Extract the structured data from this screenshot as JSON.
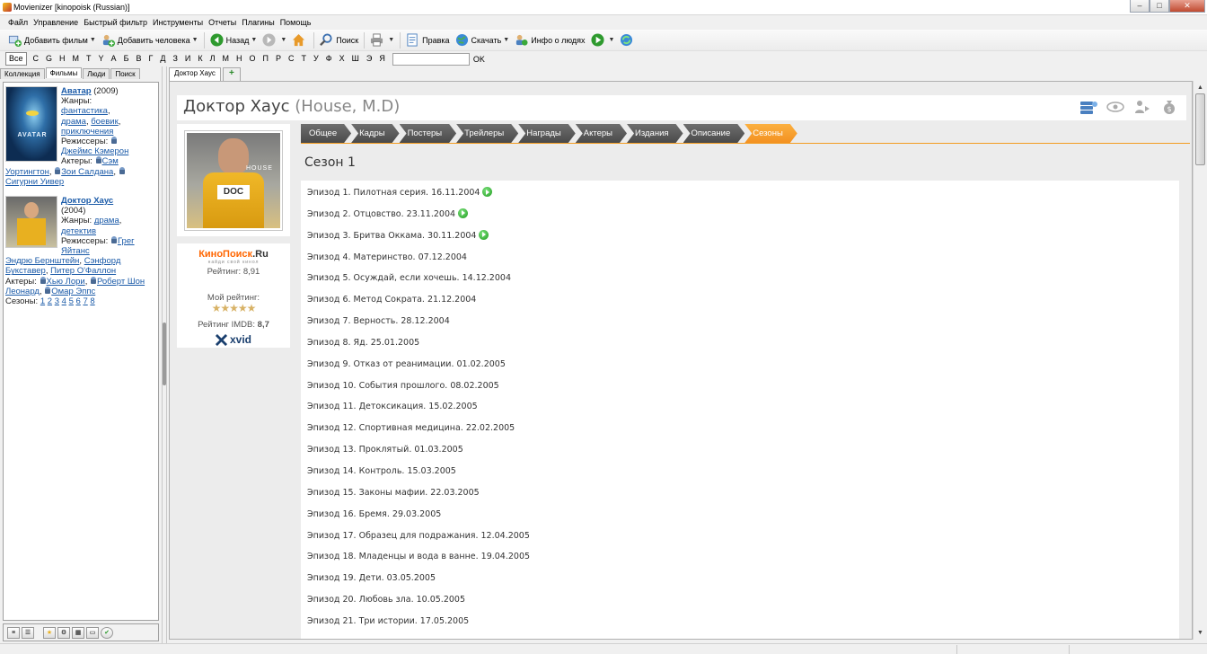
{
  "window": {
    "title": "Movienizer [kinopoisk (Russian)]"
  },
  "menu": [
    "Файл",
    "Управление",
    "Быстрый фильтр",
    "Инструменты",
    "Отчеты",
    "Плагины",
    "Помощь"
  ],
  "toolbar": {
    "add_movie": "Добавить фильм",
    "add_person": "Добавить человека",
    "back": "Назад",
    "search": "Поиск",
    "edit": "Правка",
    "download": "Скачать",
    "people_info": "Инфо о людях"
  },
  "alphabet": {
    "all": "Все",
    "letters": [
      "C",
      "G",
      "H",
      "M",
      "T",
      "Y",
      "А",
      "Б",
      "В",
      "Г",
      "Д",
      "З",
      "И",
      "К",
      "Л",
      "М",
      "Н",
      "О",
      "П",
      "Р",
      "С",
      "Т",
      "У",
      "Ф",
      "Х",
      "Ш",
      "Э",
      "Я"
    ],
    "ok": "OK",
    "filter_value": ""
  },
  "left_tabs": [
    "Коллекция",
    "Фильмы",
    "Люди",
    "Поиск"
  ],
  "left_active_tab": "Фильмы",
  "movies": [
    {
      "title": "Аватар",
      "year": "(2009)",
      "genres_label": "Жанры:",
      "genres": [
        "фантастика",
        "драма",
        "боевик",
        "приключения"
      ],
      "directors_label": "Режиссеры:",
      "directors": [
        "Джеймс Кэмерон"
      ],
      "actors_label": "Актеры:",
      "actors": [
        "Сэм Уортингтон",
        "Зои Салдана",
        "Сигурни Уивер"
      ],
      "poster_text": "AVATAR"
    },
    {
      "title": "Доктор Хаус",
      "year": "(2004)",
      "genres_label": "Жанры:",
      "genres": [
        "драма",
        "детектив"
      ],
      "directors_label": "Режиссеры:",
      "directors": [
        "Грег Яйтанс",
        "Эндрю Бернштейн",
        "Сэнфорд Букставер",
        "Питер О'Фаллон"
      ],
      "actors_label": "Актеры:",
      "actors": [
        "Хью Лори",
        "Роберт Шон Леонард",
        "Омар Эппс"
      ],
      "seasons_label": "Сезоны:",
      "seasons": [
        "1",
        "2",
        "3",
        "4",
        "5",
        "6",
        "7",
        "8"
      ]
    }
  ],
  "doc_tab": "Доктор Хаус",
  "detail": {
    "title": "Доктор Хаус",
    "original_title": "(House, M.D)",
    "poster_text": "HOUSE",
    "poster_sign": "DOC",
    "kinopoisk_logo_a": "КиноПоиск",
    "kinopoisk_logo_b": ".Ru",
    "kinopoisk_slogan": "найди свой кинол",
    "kinopoisk_rating": "Рейтинг: 8,91",
    "my_rating_label": "Мой рейтинг:",
    "imdb_label": "Рейтинг IMDB:",
    "imdb_value": "8,7",
    "xvid": "xvid",
    "tabs": [
      "Общее",
      "Кадры",
      "Постеры",
      "Трейлеры",
      "Награды",
      "Актеры",
      "Издания",
      "Описание",
      "Сезоны"
    ],
    "active_tab": "Сезоны",
    "season_title": "Сезон 1",
    "episodes": [
      {
        "text": "Эпизод 1. Пилотная серия. 16.11.2004",
        "play": true
      },
      {
        "text": "Эпизод 2. Отцовство. 23.11.2004",
        "play": true
      },
      {
        "text": "Эпизод 3. Бритва Оккама. 30.11.2004",
        "play": true
      },
      {
        "text": "Эпизод 4. Материнство. 07.12.2004",
        "play": false
      },
      {
        "text": "Эпизод 5. Осуждай, если хочешь. 14.12.2004",
        "play": false
      },
      {
        "text": "Эпизод 6. Метод Сократа. 21.12.2004",
        "play": false
      },
      {
        "text": "Эпизод 7. Верность. 28.12.2004",
        "play": false
      },
      {
        "text": "Эпизод 8. Яд. 25.01.2005",
        "play": false
      },
      {
        "text": "Эпизод 9. Отказ от реанимации. 01.02.2005",
        "play": false
      },
      {
        "text": "Эпизод 10. События прошлого. 08.02.2005",
        "play": false
      },
      {
        "text": "Эпизод 11. Детоксикация. 15.02.2005",
        "play": false
      },
      {
        "text": "Эпизод 12. Спортивная медицина. 22.02.2005",
        "play": false
      },
      {
        "text": "Эпизод 13. Проклятый. 01.03.2005",
        "play": false
      },
      {
        "text": "Эпизод 14. Контроль. 15.03.2005",
        "play": false
      },
      {
        "text": "Эпизод 15. Законы мафии. 22.03.2005",
        "play": false
      },
      {
        "text": "Эпизод 16. Бремя. 29.03.2005",
        "play": false
      },
      {
        "text": "Эпизод 17. Образец для подражания. 12.04.2005",
        "play": false
      },
      {
        "text": "Эпизод 18. Младенцы и вода в ванне. 19.04.2005",
        "play": false
      },
      {
        "text": "Эпизод 19. Дети. 03.05.2005",
        "play": false
      },
      {
        "text": "Эпизод 20. Любовь зла. 10.05.2005",
        "play": false
      },
      {
        "text": "Эпизод 21. Три истории. 17.05.2005",
        "play": false
      }
    ]
  }
}
